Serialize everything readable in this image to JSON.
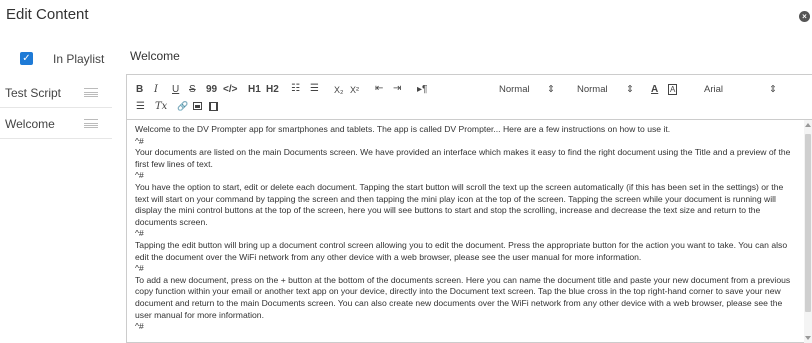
{
  "header": {
    "title": "Edit Content",
    "close_icon": "close-icon",
    "close_glyph": "×"
  },
  "sidebar": {
    "playlist_checked": true,
    "check_glyph": "✓",
    "playlist_label": "In Playlist",
    "items": [
      {
        "label": "Test Script"
      },
      {
        "label": "Welcome"
      }
    ]
  },
  "document": {
    "title": "Welcome"
  },
  "toolbar": {
    "bold": "B",
    "italic": "I",
    "underline": "U",
    "strike": "S",
    "blockquote": "99",
    "code": "</>",
    "h1": "H1",
    "h2": "H2",
    "ordered_list": "☷",
    "bullet_list": "☰",
    "subscript": "X₂",
    "superscript": "X²",
    "outdent": "⇤",
    "indent": "⇥",
    "direction": "▸¶",
    "size_select": "Normal",
    "header_select": "Normal",
    "font_color": "A",
    "background_color": "A",
    "font_family": "Arial",
    "align": "☰",
    "clean": "Tx",
    "link_icon": "link-icon",
    "image_icon": "image-icon",
    "video_icon": "video-icon",
    "link_glyph": "🔗",
    "select_arrow": "⇕"
  },
  "content": {
    "paragraphs": [
      "Welcome to the DV Prompter app for smartphones and tablets. The app is called DV Prompter... Here are a few instructions on how to use it.",
      "^#",
      "Your documents are listed on the main Documents screen. We have provided an interface which makes it easy to find the right document using the Title and a preview of the first few lines of text.",
      "^#",
      "You have the option to start, edit or delete each document. Tapping the start button will scroll the text up the screen automatically (if this has been set in the settings) or the text will start on your command by tapping the screen and then tapping the mini play icon at the top of the screen. Tapping the screen while your document is running will display the mini control buttons at the top of the screen, here you will see buttons to start and stop the scrolling, increase and decrease the text size and return to the documents screen.",
      "^#",
      "Tapping the edit button will bring up a document control screen allowing you to edit the document. Press the appropriate button for the action you want to take. You can also edit the document over the WiFi network from any other device with a web browser, please see the user manual for more information.",
      "^#",
      "To add a new document, press on the + button at the bottom of the documents screen. Here you can name the document title and paste your new document from a previous copy function within your email or another text app on your device, directly into the Document text screen. Tap the blue cross in the top right-hand corner to save your new document and return to the main Documents screen. You can also create new documents over the WiFi network from any other device with a web browser, please see the user manual for more information.",
      "^#"
    ]
  },
  "colors": {
    "accent": "#1e7ad6",
    "border": "#cccccc",
    "text": "#333333"
  }
}
